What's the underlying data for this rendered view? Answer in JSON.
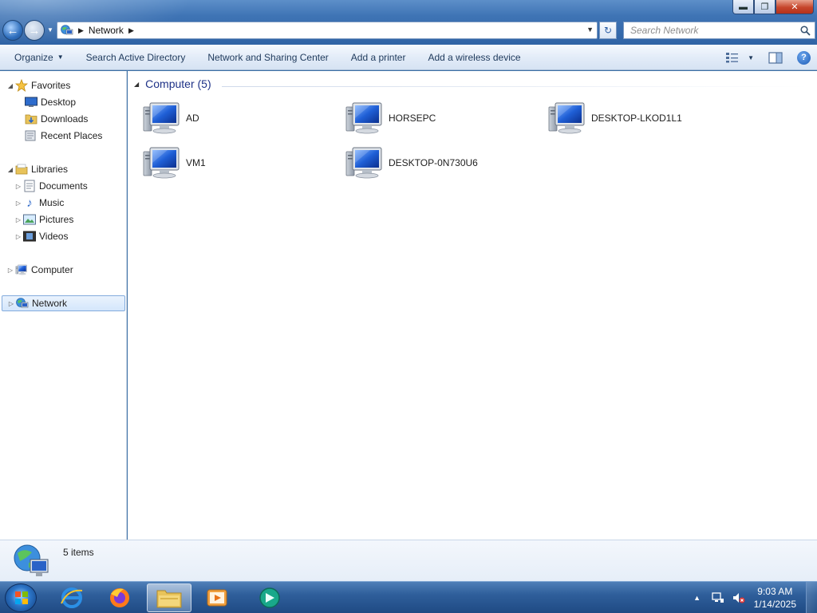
{
  "window": {
    "controls": {
      "minimize": "▬",
      "maximize": "❐",
      "close": "✕"
    }
  },
  "address": {
    "crumbs": [
      "Network"
    ],
    "search_placeholder": "Search Network"
  },
  "toolbar": {
    "organize_label": "Organize",
    "items": [
      "Search Active Directory",
      "Network and Sharing Center",
      "Add a printer",
      "Add a wireless device"
    ]
  },
  "navigation": {
    "favorites": {
      "label": "Favorites",
      "items": [
        "Desktop",
        "Downloads",
        "Recent Places"
      ]
    },
    "libraries": {
      "label": "Libraries",
      "items": [
        "Documents",
        "Music",
        "Pictures",
        "Videos"
      ]
    },
    "computer": {
      "label": "Computer"
    },
    "network": {
      "label": "Network"
    }
  },
  "content": {
    "group_title": "Computer (5)",
    "computers": [
      "AD",
      "HORSEPC",
      "DESKTOP-LKOD1L1",
      "VM1",
      "DESKTOP-0N730U6"
    ]
  },
  "details": {
    "item_count": "5 items"
  },
  "taskbar": {
    "pinned": [
      "internet-explorer-icon",
      "firefox-icon",
      "windows-explorer-icon",
      "media-player-icon",
      "remote-app-icon"
    ],
    "clock_time": "9:03 AM",
    "clock_date": "1/14/2025"
  },
  "colors": {
    "accent": "#2f63a5",
    "selection": "#d4e6fb",
    "group_header": "#1e3287"
  }
}
